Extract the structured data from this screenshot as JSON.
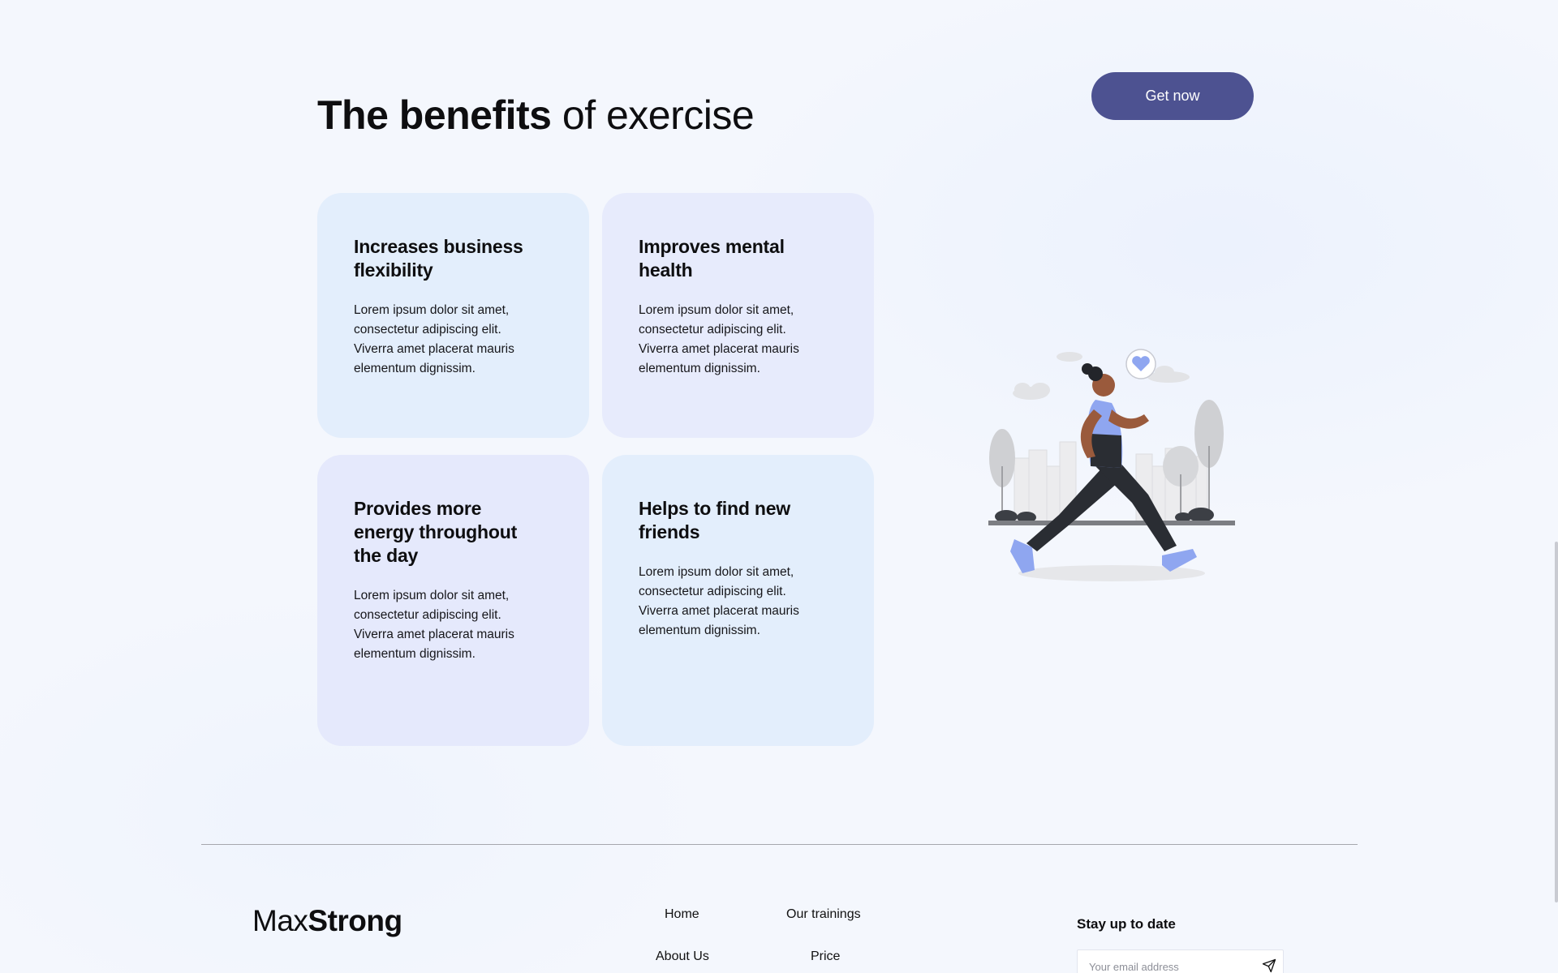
{
  "hero": {
    "title_bold": "The benefits",
    "title_rest": "of exercise",
    "cta_label": "Get now"
  },
  "benefits": [
    {
      "title": "Increases business flexibility",
      "text": "Lorem ipsum dolor sit amet, consectetur adipiscing elit. Viverra amet placerat mauris elementum dignissim."
    },
    {
      "title": "Improves mental health",
      "text": "Lorem ipsum dolor sit amet, consectetur adipiscing elit. Viverra amet placerat mauris elementum dignissim."
    },
    {
      "title": "Provides more energy throughout the day",
      "text": "Lorem ipsum dolor sit amet, consectetur adipiscing elit. Viverra amet placerat mauris elementum dignissim."
    },
    {
      "title": "Helps to find new friends",
      "text": "Lorem ipsum dolor sit amet, consectetur adipiscing elit. Viverra amet placerat mauris elementum dignissim."
    }
  ],
  "illustration": {
    "icon": "runner-illustration"
  },
  "footer": {
    "logo_light": "Max",
    "logo_bold": "Strong",
    "nav": {
      "home": "Home",
      "trainings": "Our trainings",
      "about": "About Us",
      "price": "Price"
    },
    "subscribe_title": "Stay up to date",
    "email_placeholder": "Your email address",
    "send_icon": "send-icon"
  },
  "colors": {
    "background": "#f4f7fd",
    "accent": "#4d5291",
    "card_blue": "#e3eefc",
    "card_lavender": "#e7ebfc",
    "figure_blue": "#8fa6f0"
  }
}
